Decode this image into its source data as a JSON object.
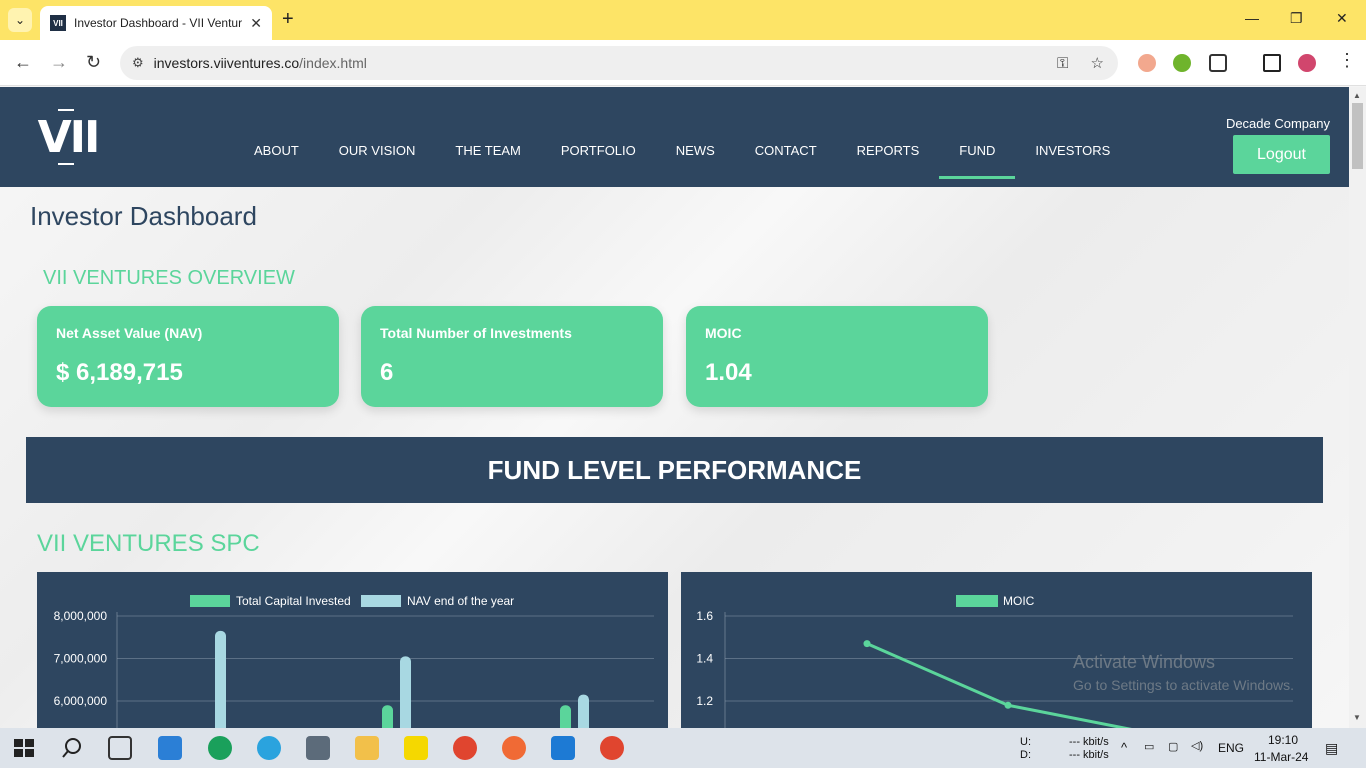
{
  "browser": {
    "tab_title": "Investor Dashboard - VII Ventur",
    "favicon": "VII",
    "url_host": "investors.viiventures.co",
    "url_path": "/index.html"
  },
  "site": {
    "logo": "VII",
    "nav": [
      "ABOUT",
      "OUR VISION",
      "THE TEAM",
      "PORTFOLIO",
      "NEWS",
      "CONTACT",
      "REPORTS",
      "FUND",
      "INVESTORS"
    ],
    "active_nav": "FUND",
    "company": "Decade Company",
    "logout_label": "Logout"
  },
  "dashboard": {
    "title": "Investor Dashboard",
    "overview_title": "VII VENTURES OVERVIEW",
    "cards": [
      {
        "label": "Net Asset Value (NAV)",
        "value": "$ 6,189,715"
      },
      {
        "label": "Total Number of Investments",
        "value": "6"
      },
      {
        "label": "MOIC",
        "value": "1.04"
      }
    ],
    "banner": "FUND LEVEL PERFORMANCE",
    "spc_title": "VII VENTURES SPC"
  },
  "colors": {
    "navy": "#2e4660",
    "green": "#5bd59b",
    "light_blue": "#a8d8e2"
  },
  "chart_data": [
    {
      "type": "bar",
      "series": [
        {
          "name": "Total Capital Invested",
          "values": [
            null,
            5900000,
            5900000
          ]
        },
        {
          "name": "NAV end of the year",
          "values": [
            7650000,
            7050000,
            6150000
          ]
        }
      ],
      "y_ticks": [
        "8,000,000",
        "7,000,000",
        "6,000,000"
      ],
      "ylim": [
        5500000,
        8200000
      ],
      "legend": "top"
    },
    {
      "type": "line",
      "series": [
        {
          "name": "MOIC",
          "values": [
            1.47,
            1.18,
            1.05
          ]
        }
      ],
      "y_ticks": [
        "1.6",
        "1.4",
        "1.2"
      ],
      "ylim": [
        1.0,
        1.65
      ],
      "legend": "top"
    }
  ],
  "watermark": {
    "line1": "Activate Windows",
    "line2": "Go to Settings to activate Windows."
  },
  "taskbar": {
    "net_u": "U:",
    "net_d": "D:",
    "rate_u": "--- kbit/s",
    "rate_d": "--- kbit/s",
    "lang": "ENG",
    "time": "19:10",
    "date": "11-Mar-24"
  }
}
